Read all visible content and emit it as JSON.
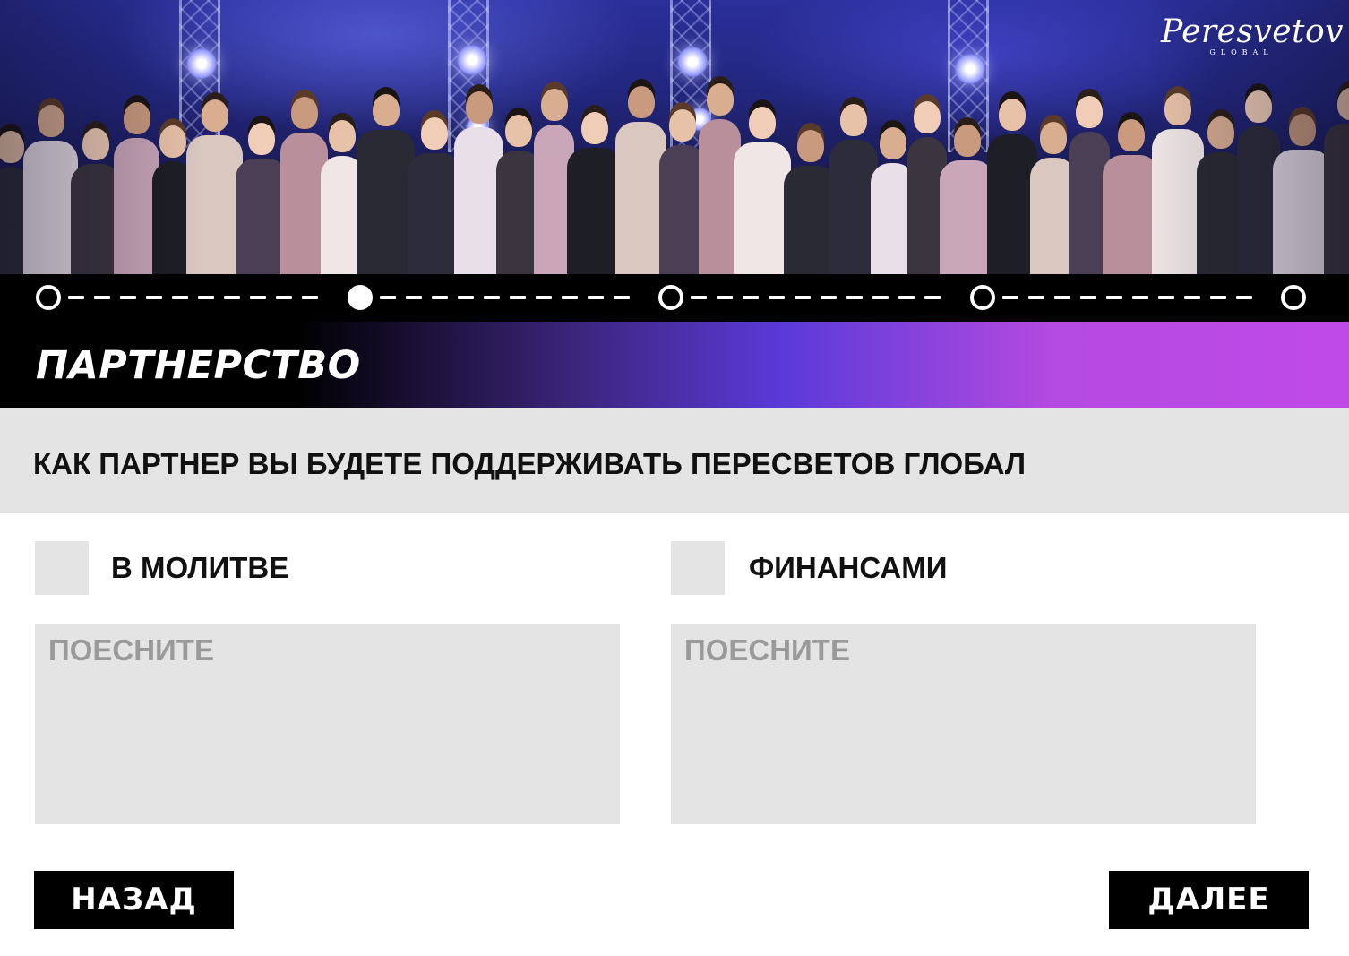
{
  "brand": {
    "logo_script": "Peresvetov",
    "logo_sub": "GLOBAL"
  },
  "progress": {
    "total_steps": 5,
    "current_step": 2
  },
  "section": {
    "title": "ПАРТНЕРСТВО"
  },
  "question": {
    "text": "КАК ПАРТНЕР ВЫ БУДЕТЕ ПОДДЕРЖИВАТЬ ПЕРЕСВЕТОВ ГЛОБАЛ"
  },
  "options": [
    {
      "label": "В МОЛИТВЕ",
      "checked": false,
      "explain_placeholder": "ПОЕСНИТЕ",
      "explain_value": ""
    },
    {
      "label": "ФИНАНСАМИ",
      "checked": false,
      "explain_placeholder": "ПОЕСНИТЕ",
      "explain_value": ""
    }
  ],
  "nav": {
    "back_label": "НАЗАД",
    "next_label": "ДАЛЕЕ"
  },
  "colors": {
    "header_gradient_end": "#c04ae8",
    "field_background": "#e4e4e4",
    "button_background": "#000000"
  }
}
